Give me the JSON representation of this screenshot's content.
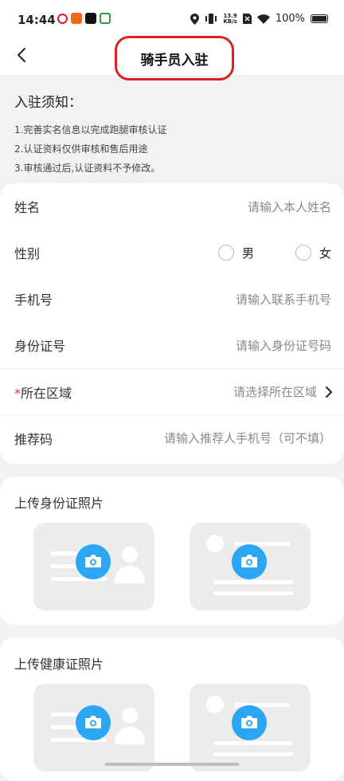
{
  "status_bar": {
    "time": "14:44",
    "speed_top": "13.9",
    "speed_bottom": "KB/s",
    "battery": "100%"
  },
  "nav": {
    "title": "骑手员入驻"
  },
  "notice": {
    "heading": "入驻须知：",
    "lines": [
      "1.完善实名信息以完成跑腿审核认证",
      "2.认证资料仅供审核和售后用途",
      "3.审核通过后,认证资料不予修改。"
    ]
  },
  "form": {
    "name": {
      "label": "姓名",
      "placeholder": "请输入本人姓名"
    },
    "gender": {
      "label": "性别",
      "male": "男",
      "female": "女"
    },
    "phone": {
      "label": "手机号",
      "placeholder": "请输入联系手机号"
    },
    "id_number": {
      "label": "身份证号",
      "placeholder": "请输入身份证号码"
    },
    "region": {
      "required_mark": "*",
      "label": "所在区域",
      "placeholder": "请选择所在区域"
    },
    "referral": {
      "label": "推荐码",
      "placeholder": "请输入推荐人手机号（可不填）"
    }
  },
  "upload_id": {
    "title": "上传身份证照片"
  },
  "upload_health": {
    "title": "上传健康证照片"
  },
  "colors": {
    "accent": "#2aa6f2",
    "highlight": "#e02020",
    "required": "#e03030"
  }
}
